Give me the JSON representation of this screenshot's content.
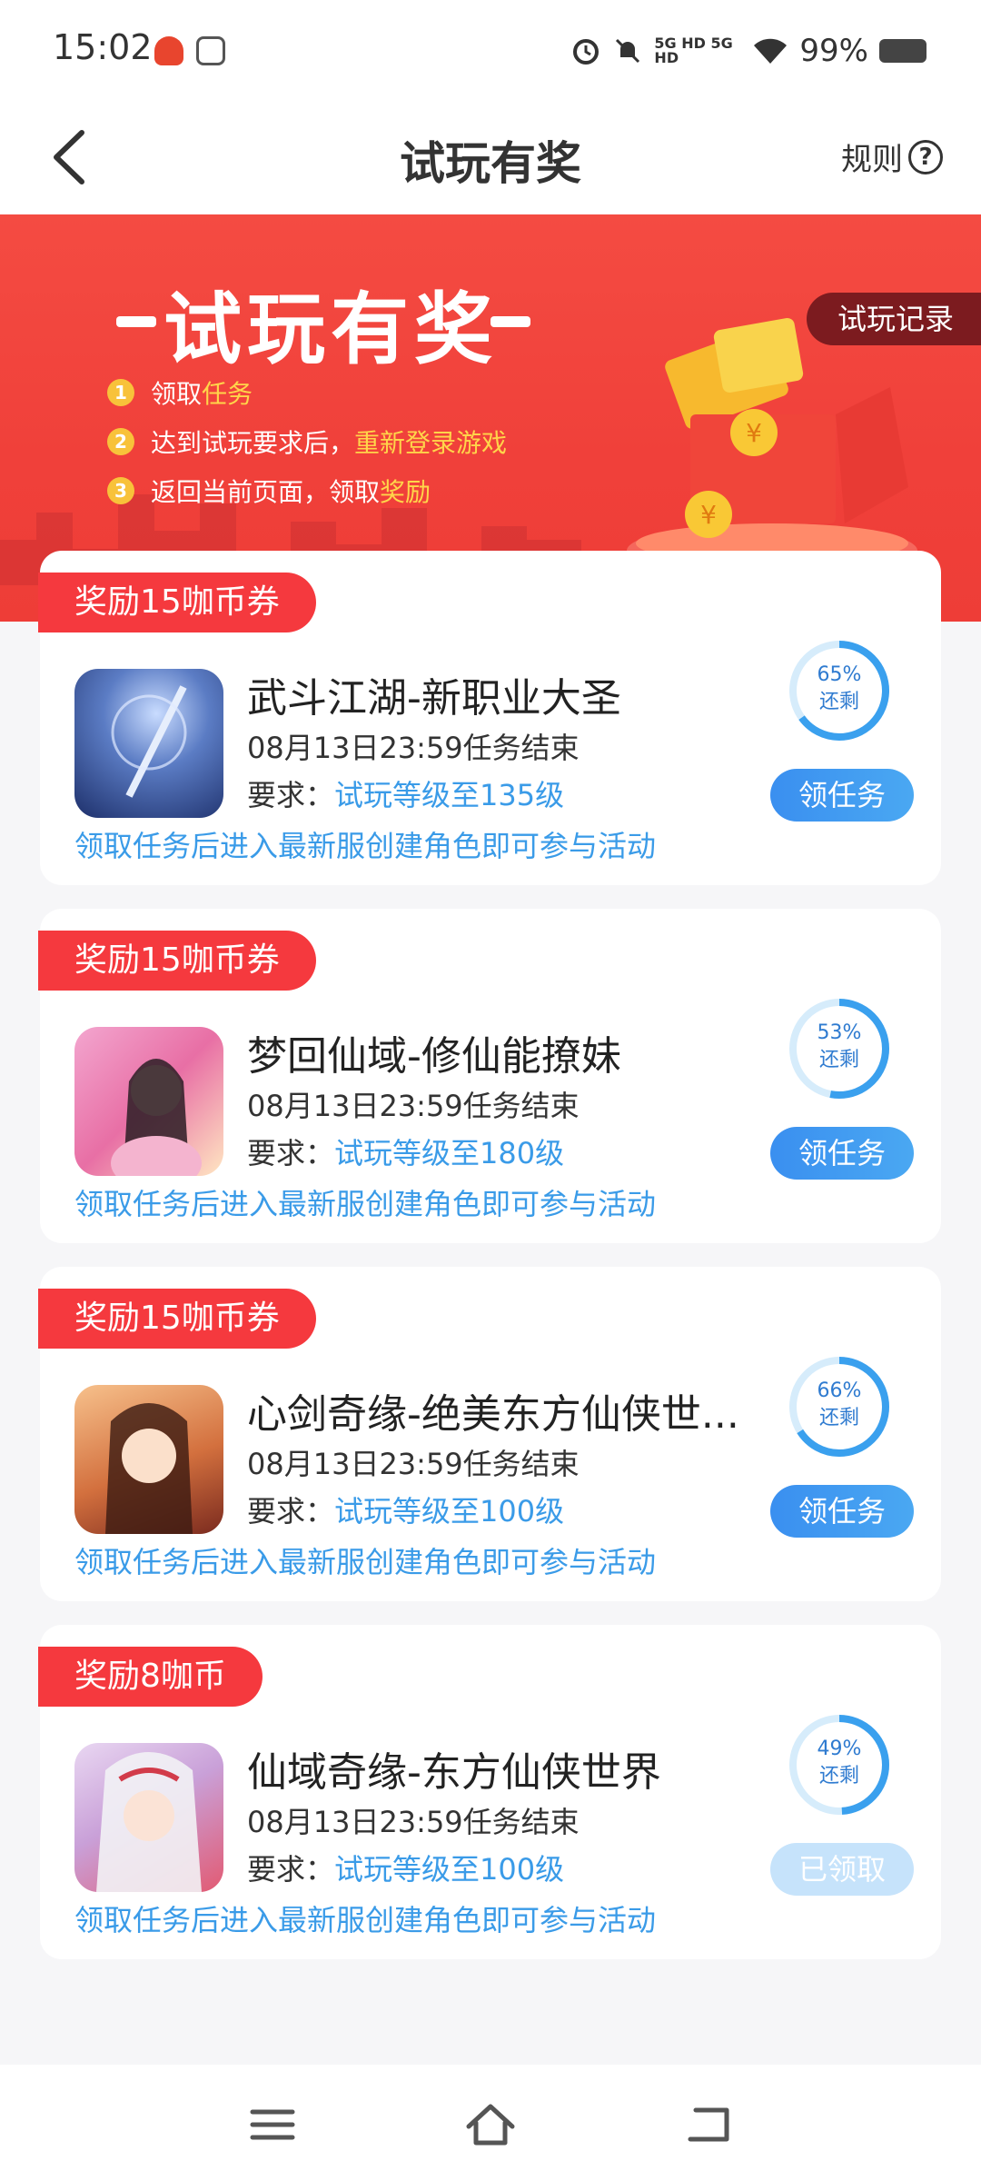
{
  "status_bar": {
    "time": "15:02",
    "network": "5G HD 5G HD",
    "battery": "99%"
  },
  "header": {
    "title": "试玩有奖",
    "rules_label": "规则"
  },
  "banner": {
    "title": "试玩有奖",
    "record_button": "试玩记录",
    "steps": [
      {
        "num": "1",
        "text": "领取",
        "highlight": "任务"
      },
      {
        "num": "2",
        "text": "达到试玩要求后，",
        "highlight": "重新登录游戏"
      },
      {
        "num": "3",
        "text": "返回当前页面，领取",
        "highlight": "奖励"
      }
    ]
  },
  "tasks": [
    {
      "reward": "奖励15咖币券",
      "name": "武斗江湖-新职业大圣",
      "deadline": "08月13日23:59任务结束",
      "req_label": "要求：",
      "req_value": "试玩等级至135级",
      "note": "领取任务后进入最新服创建角色即可参与活动",
      "percent": "65%",
      "remaining_label": "还剩",
      "remaining_fraction": 0.65,
      "button": "领任务",
      "button_state": "active"
    },
    {
      "reward": "奖励15咖币券",
      "name": "梦回仙域-修仙能撩妹",
      "deadline": "08月13日23:59任务结束",
      "req_label": "要求：",
      "req_value": "试玩等级至180级",
      "note": "领取任务后进入最新服创建角色即可参与活动",
      "percent": "53%",
      "remaining_label": "还剩",
      "remaining_fraction": 0.53,
      "button": "领任务",
      "button_state": "active"
    },
    {
      "reward": "奖励15咖币券",
      "name": "心剑奇缘-绝美东方仙侠世...",
      "deadline": "08月13日23:59任务结束",
      "req_label": "要求：",
      "req_value": "试玩等级至100级",
      "note": "领取任务后进入最新服创建角色即可参与活动",
      "percent": "66%",
      "remaining_label": "还剩",
      "remaining_fraction": 0.66,
      "button": "领任务",
      "button_state": "active"
    },
    {
      "reward": "奖励8咖币",
      "name": "仙域奇缘-东方仙侠世界",
      "deadline": "08月13日23:59任务结束",
      "req_label": "要求：",
      "req_value": "试玩等级至100级",
      "note": "领取任务后进入最新服创建角色即可参与活动",
      "percent": "49%",
      "remaining_label": "还剩",
      "remaining_fraction": 0.49,
      "button": "已领取",
      "button_state": "claimed"
    }
  ],
  "colors": {
    "banner_red": "#f0403a",
    "tag_red": "#f5393e",
    "link_blue": "#3a9be8",
    "button_blue": "#3a8ff0",
    "highlight_yellow": "#ffd54a"
  }
}
